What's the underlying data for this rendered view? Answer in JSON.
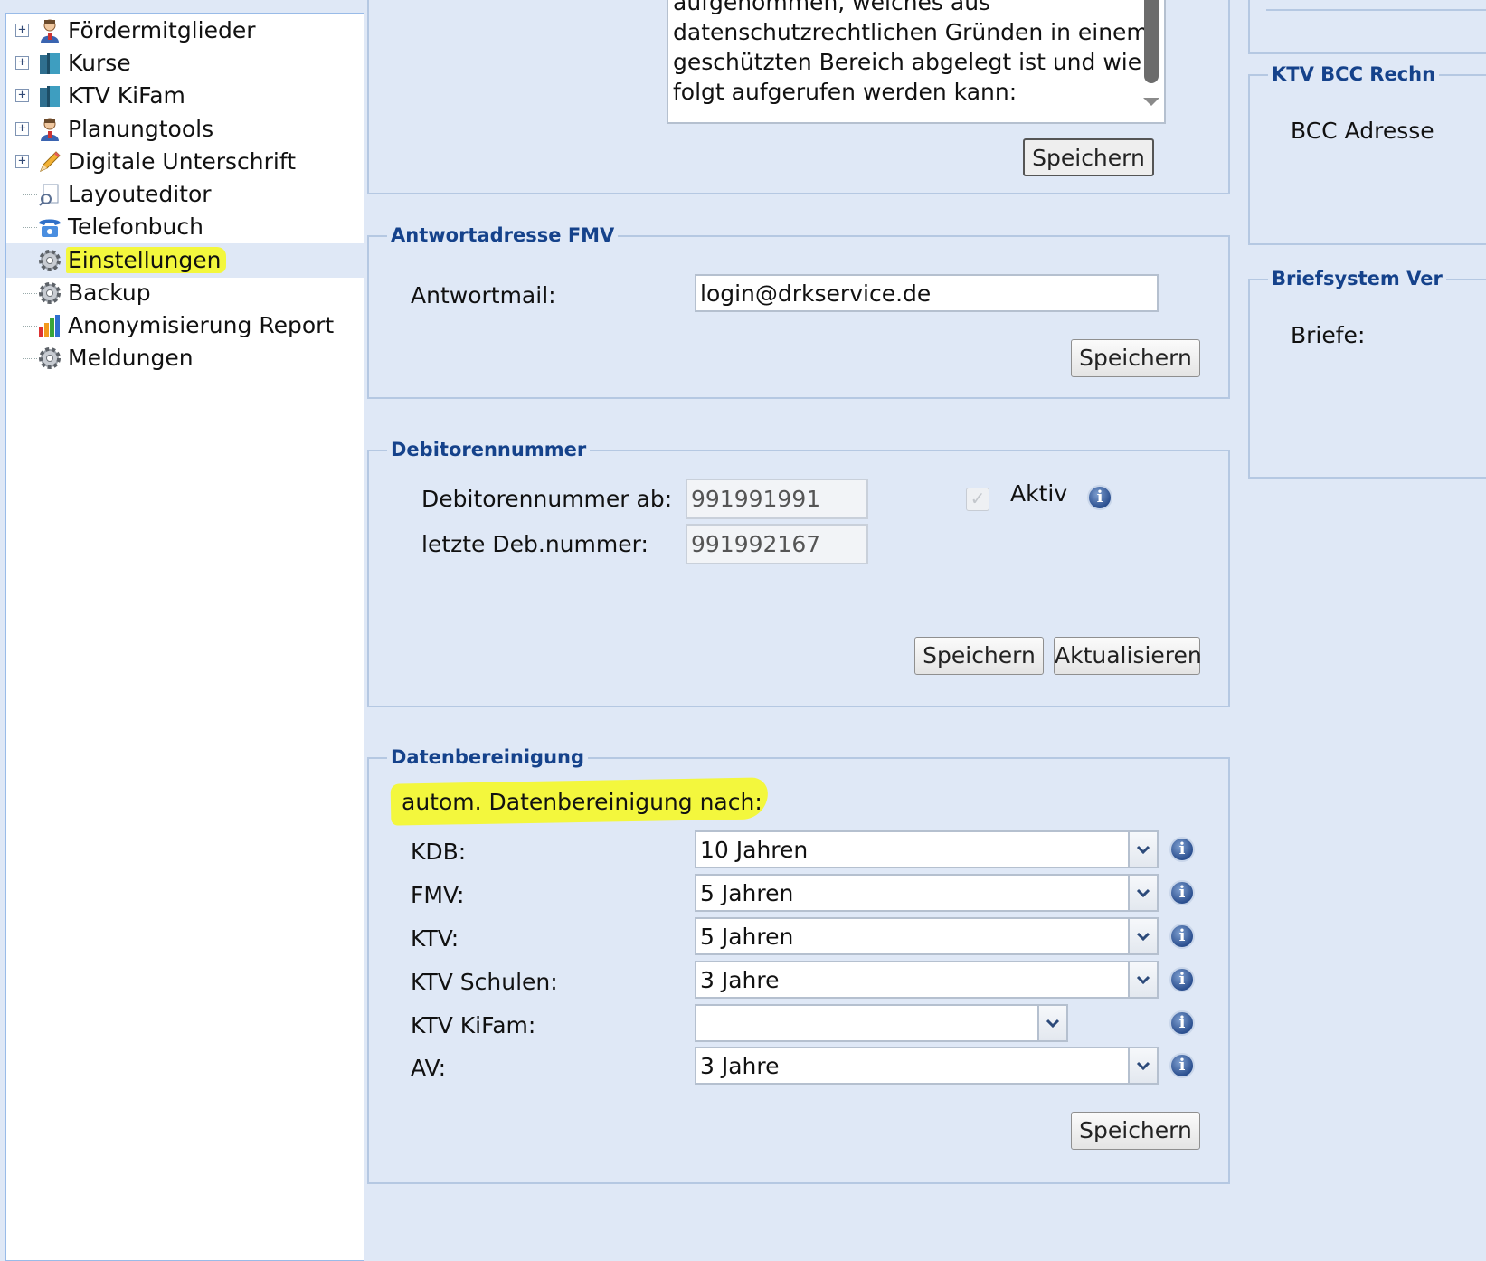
{
  "tree": {
    "items": [
      {
        "label": "Fördermitglieder",
        "icon": "user-icon"
      },
      {
        "label": "Kurse",
        "icon": "book-icon"
      },
      {
        "label": "KTV KiFam",
        "icon": "book-icon"
      },
      {
        "label": "Planungtools",
        "icon": "user-icon"
      },
      {
        "label": "Digitale Unterschrift",
        "icon": "pencil-icon"
      },
      {
        "label": "Layouteditor",
        "icon": "layout-icon"
      },
      {
        "label": "Telefonbuch",
        "icon": "phone-icon"
      },
      {
        "label": "Einstellungen",
        "icon": "gear-icon",
        "selected": true
      },
      {
        "label": "Backup",
        "icon": "gear-icon"
      },
      {
        "label": "Anonymisierung Report",
        "icon": "bar-chart-icon"
      },
      {
        "label": "Meldungen",
        "icon": "gear-icon"
      }
    ]
  },
  "top_panel": {
    "text_lines": [
      "aufgenommen, welches aus",
      "datenschutzrechtlichen Gründen in einem",
      "geschützten Bereich abgelegt ist und wie",
      "folgt aufgerufen werden kann:"
    ],
    "save_label": "Speichern"
  },
  "antwortadresse": {
    "legend": "Antwortadresse FMV",
    "mail_label": "Antwortmail:",
    "mail_value": "login@drkservice.de",
    "save_label": "Speichern"
  },
  "debitoren": {
    "legend": "Debitorennummer",
    "from_label": "Debitorennummer ab:",
    "from_value": "991991991",
    "last_label": "letzte Deb.nummer:",
    "last_value": "991992167",
    "aktiv_label": "Aktiv",
    "save_label": "Speichern",
    "refresh_label": "Aktualisieren"
  },
  "datenbereinigung": {
    "legend": "Datenbereinigung",
    "heading": "autom. Datenbereinigung nach:",
    "rows": [
      {
        "label": "KDB:",
        "value": "10 Jahren"
      },
      {
        "label": "FMV:",
        "value": "5 Jahren"
      },
      {
        "label": "KTV:",
        "value": "5 Jahren"
      },
      {
        "label": "KTV Schulen:",
        "value": "3 Jahre"
      },
      {
        "label": "KTV KiFam:",
        "value": ""
      },
      {
        "label": "AV:",
        "value": "3 Jahre"
      }
    ],
    "save_label": "Speichern"
  },
  "right_column": {
    "bcc_legend": "KTV BCC Rechn",
    "bcc_label": "BCC Adresse",
    "brief_legend": "Briefsystem Ver",
    "brief_label": "Briefe:"
  },
  "colors": {
    "highlight": "#f3f73d",
    "legend": "#15428b",
    "background": "#dfe8f6"
  }
}
